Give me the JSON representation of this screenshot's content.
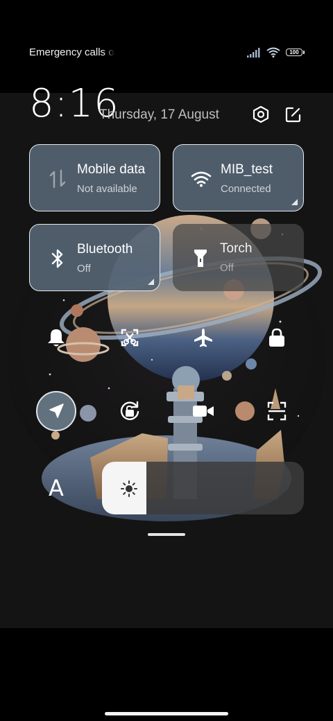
{
  "status_bar": {
    "carrier_text": "Emergency calls only",
    "battery_level": "100"
  },
  "header": {
    "time": "8:16",
    "date": "Thursday, 17 August",
    "settings_icon": "hexagon-settings-icon",
    "edit_icon": "edit-icon"
  },
  "tiles": [
    {
      "id": "mobile-data",
      "title": "Mobile data",
      "subtitle": "Not available",
      "state": "active",
      "icon": "mobile-data-icon"
    },
    {
      "id": "wifi",
      "title": "MIB_test",
      "subtitle": "Connected",
      "state": "active",
      "icon": "wifi-icon"
    },
    {
      "id": "bluetooth",
      "title": "Bluetooth",
      "subtitle": "Off",
      "state": "active",
      "icon": "bluetooth-icon"
    },
    {
      "id": "torch",
      "title": "Torch",
      "subtitle": "Off",
      "state": "inactive",
      "icon": "torch-icon"
    }
  ],
  "toggles": {
    "row1": [
      "bell-icon",
      "screenshot-icon",
      "airplane-icon",
      "lock-icon"
    ],
    "row2": [
      "location-icon",
      "rotation-lock-icon",
      "video-camera-icon",
      "scan-icon"
    ],
    "location_on": true
  },
  "brightness": {
    "level": 0.22,
    "icon": "sun-icon"
  },
  "font_size_label": "A",
  "colors": {
    "active_tile": "#556473",
    "inactive_tile": "#484848",
    "background": "#000000"
  }
}
